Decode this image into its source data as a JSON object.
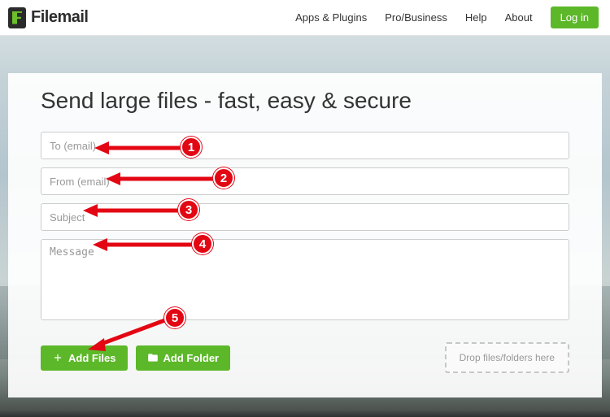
{
  "brand": {
    "name": "Filemail"
  },
  "nav": {
    "apps": "Apps & Plugins",
    "pro": "Pro/Business",
    "help": "Help",
    "about": "About",
    "login": "Log in"
  },
  "form": {
    "title": "Send large files - fast, easy & secure",
    "to_placeholder": "To (email)",
    "from_placeholder": "From (email)",
    "subject_placeholder": "Subject",
    "message_placeholder": "Message",
    "to_value": "",
    "from_value": "",
    "subject_value": "",
    "message_value": ""
  },
  "actions": {
    "add_files": "Add Files",
    "add_folder": "Add Folder",
    "drop_hint": "Drop files/folders here"
  },
  "annotations": {
    "a1": "1",
    "a2": "2",
    "a3": "3",
    "a4": "4",
    "a5": "5"
  }
}
